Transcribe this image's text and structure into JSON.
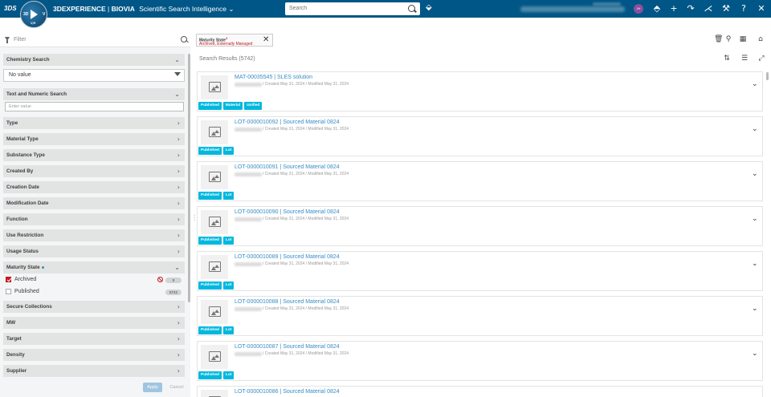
{
  "topbar": {
    "logo": "3DS",
    "compass_left": "3D",
    "compass_right": "V",
    "compass_bottom": "V,R",
    "brand_3dx": "3DEXPERIENCE",
    "brand_sep": " | ",
    "brand_biovia": "BIOVIA",
    "app_name": "Scientific Search Intelligence",
    "app_chev": "⌄",
    "search_placeholder": "Search",
    "avatar": "JH",
    "icons": [
      "tag-icon",
      "share-icon",
      "add-icon",
      "forward-icon",
      "network-icon",
      "tools-icon",
      "help-icon",
      "compass-layout-icon"
    ]
  },
  "left": {
    "filter_placeholder": "Filter",
    "chemistry_search": "Chemistry Search",
    "no_value": "No value",
    "text_numeric": "Text and Numeric Search",
    "enter_value": "Enter value",
    "sections_top": [
      "Type",
      "Material Type",
      "Substance Type",
      "Created By",
      "Creation Date",
      "Modification Date",
      "Function",
      "Use Restriction",
      "Usage Status"
    ],
    "maturity_state": "Maturity State",
    "maturity_options": [
      {
        "label": "Archived",
        "count": "0"
      },
      {
        "label": "Published",
        "count": "5742"
      }
    ],
    "sections_bottom": [
      "Secure Collections",
      "MW",
      "Target",
      "Density",
      "Supplier"
    ],
    "apply": "Apply",
    "cancel": "Cancel"
  },
  "right": {
    "chip_title": "Maturity State",
    "chip_sup": "2",
    "chip_value": "Archived, Externally Managed",
    "results_label": "Search Results (5742)",
    "cards": [
      {
        "title": "MAT-00035545 | SLES solution",
        "meta": "/ Created May 31, 2024 / Modified May 31, 2024",
        "badges": [
          "Published",
          "Material",
          "Unified"
        ]
      },
      {
        "title": "LOT-0000010092 | Sourced Material 0824",
        "meta": "/ Created May 31, 2024 / Modified May 31, 2024",
        "badges": [
          "Published",
          "Lot"
        ]
      },
      {
        "title": "LOT-0000010091 | Sourced Material 0824",
        "meta": "/ Created May 31, 2024 / Modified May 31, 2024",
        "badges": [
          "Published",
          "Lot"
        ]
      },
      {
        "title": "LOT-0000010090 | Sourced Material 0824",
        "meta": "/ Created May 31, 2024 / Modified May 31, 2024",
        "badges": [
          "Published",
          "Lot"
        ]
      },
      {
        "title": "LOT-0000010089 | Sourced Material 0824",
        "meta": "/ Created May 31, 2024 / Modified May 31, 2024",
        "badges": [
          "Published",
          "Lot"
        ]
      },
      {
        "title": "LOT-0000010088 | Sourced Material 0824",
        "meta": "/ Created May 31, 2024 / Modified May 31, 2024",
        "badges": [
          "Published",
          "Lot"
        ]
      },
      {
        "title": "LOT-0000010087 | Sourced Material 0824",
        "meta": "/ Created May 31, 2024 / Modified May 31, 2024",
        "badges": [
          "Published",
          "Lot"
        ]
      },
      {
        "title": "LOT-0000010086 | Sourced Material 0824",
        "meta": "",
        "badges": []
      }
    ]
  }
}
